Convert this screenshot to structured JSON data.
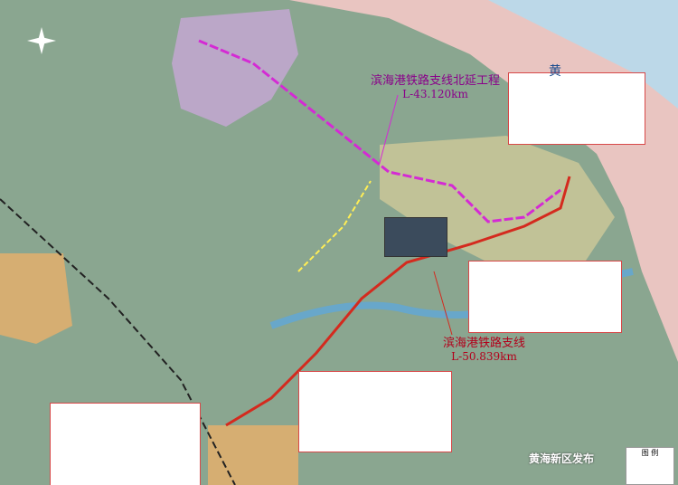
{
  "route_north": {
    "title": "滨海港铁路支线北延工程",
    "length": "L-43.120km"
  },
  "route_main": {
    "title": "滨海港铁路支线",
    "length": "L-50.839km"
  },
  "sea_label": "黄",
  "legend_title": "图 例",
  "watermark": "黄海新区发布",
  "colors": {
    "north_line": "#d42ad4",
    "main_line": "#d42a1e",
    "sea": "#f3c9c6",
    "land": "#8aa690",
    "river": "#5fa8d8"
  }
}
